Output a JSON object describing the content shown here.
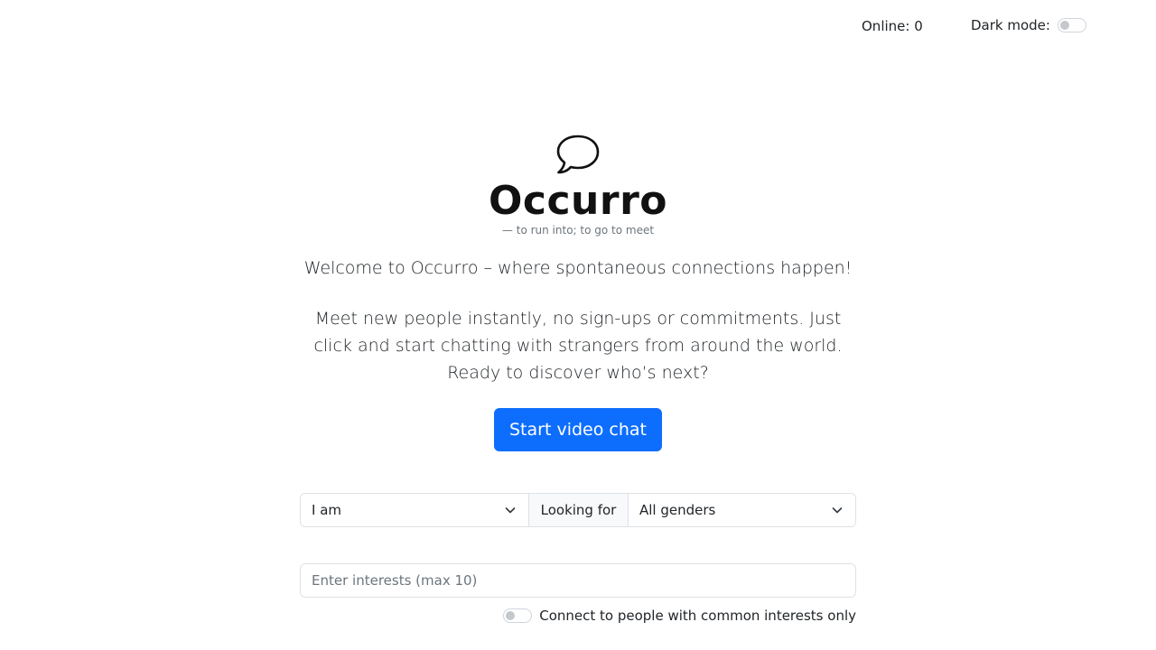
{
  "header": {
    "online_label": "Online: 0",
    "dark_mode_label": "Dark mode:",
    "dark_mode_on": false
  },
  "hero": {
    "logo_icon": "speech-bubble-icon",
    "brand": "Occurro",
    "tagline": "— to run into; to go to meet",
    "welcome": "Welcome to Occurro – where spontaneous connections happen!",
    "description": "Meet new people instantly, no sign-ups or commitments. Just click and start chatting with strangers from around the world. Ready to discover who’s next?",
    "start_button": "Start video chat"
  },
  "filters": {
    "i_am_selected": "I am",
    "looking_for_label": "Looking for",
    "gender_selected": "All genders"
  },
  "interests": {
    "placeholder": "Enter interests (max 10)",
    "common_only_label": "Connect to people with common interests only",
    "common_only_on": false
  },
  "colors": {
    "primary": "#0d6efd",
    "text": "#212529",
    "muted": "#6c757d",
    "border": "#dee2e6"
  }
}
